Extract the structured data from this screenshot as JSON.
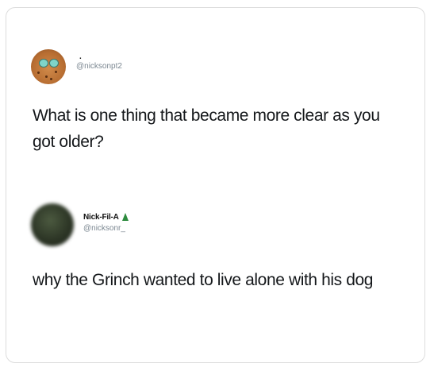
{
  "tweet1": {
    "display_name": ".",
    "handle": "@nicksonpt2",
    "text": "What is one thing that became more clear as you got older?"
  },
  "tweet2": {
    "display_name": "Nick-Fil-A",
    "handle": "@nicksonr_",
    "text": "why the Grinch wanted to live alone with his dog"
  }
}
